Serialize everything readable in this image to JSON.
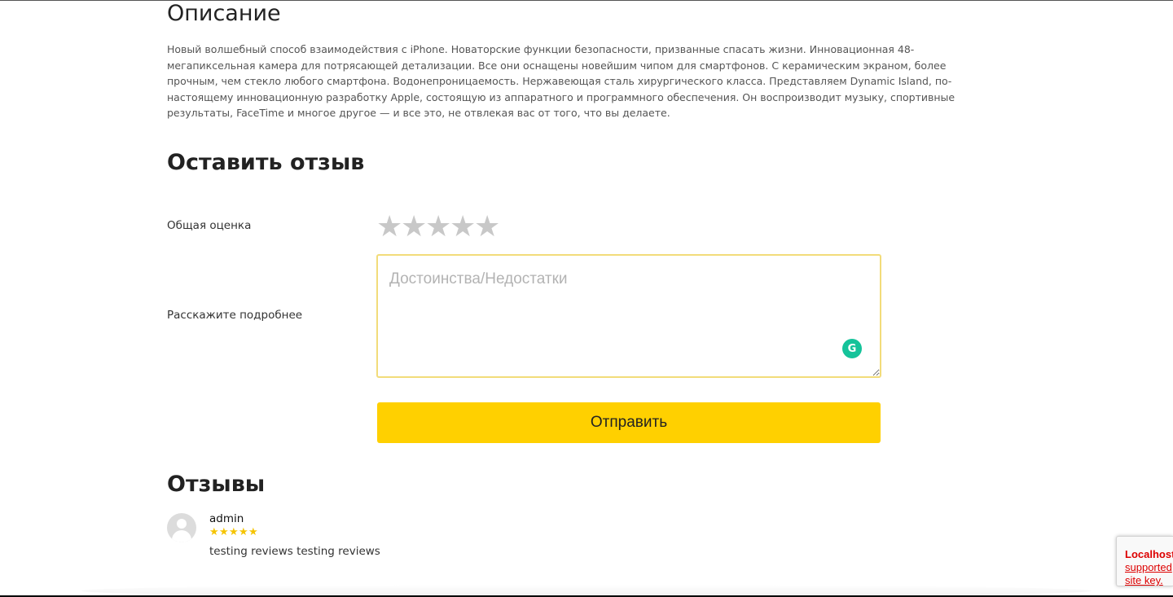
{
  "description": {
    "title": "Описание",
    "text": "Новый волшебный способ взаимодействия с iPhone. Новаторские функции безопасности, призванные спасать жизни. Инновационная 48-мегапиксельная камера для потрясающей детализации. Все они оснащены новейшим чипом для смартфонов. С керамическим экраном, более прочным, чем стекло любого смартфона. Водонепроницаемость. Нержавеющая сталь хирургического класса. Представляем Dynamic Island, по-настоящему инновационную разработку Apple, состоящую из аппаратного и программного обеспечения. Он воспроизводит музыку, спортивные результаты, FaceTime и многое другое — и все это, не отвлекая вас от того, что вы делаете."
  },
  "review_form": {
    "title": "Оставить отзыв",
    "rating_label": "Общая оценка",
    "rating_value": 0,
    "rating_max": 5,
    "star_glyph": "★",
    "details_label": "Расскажите подробнее",
    "textarea_placeholder": "Достоинства/Недостатки",
    "textarea_value": "",
    "grammarly_glyph": "G",
    "submit_label": "Отправить",
    "accent_color": "#ffd000"
  },
  "reviews": {
    "title": "Отзывы",
    "items": [
      {
        "author": "admin",
        "rating": 5,
        "text": "testing reviews testing reviews"
      }
    ]
  },
  "recaptcha": {
    "line1": "Localhost",
    "line2": "supported",
    "line3": "site key."
  }
}
